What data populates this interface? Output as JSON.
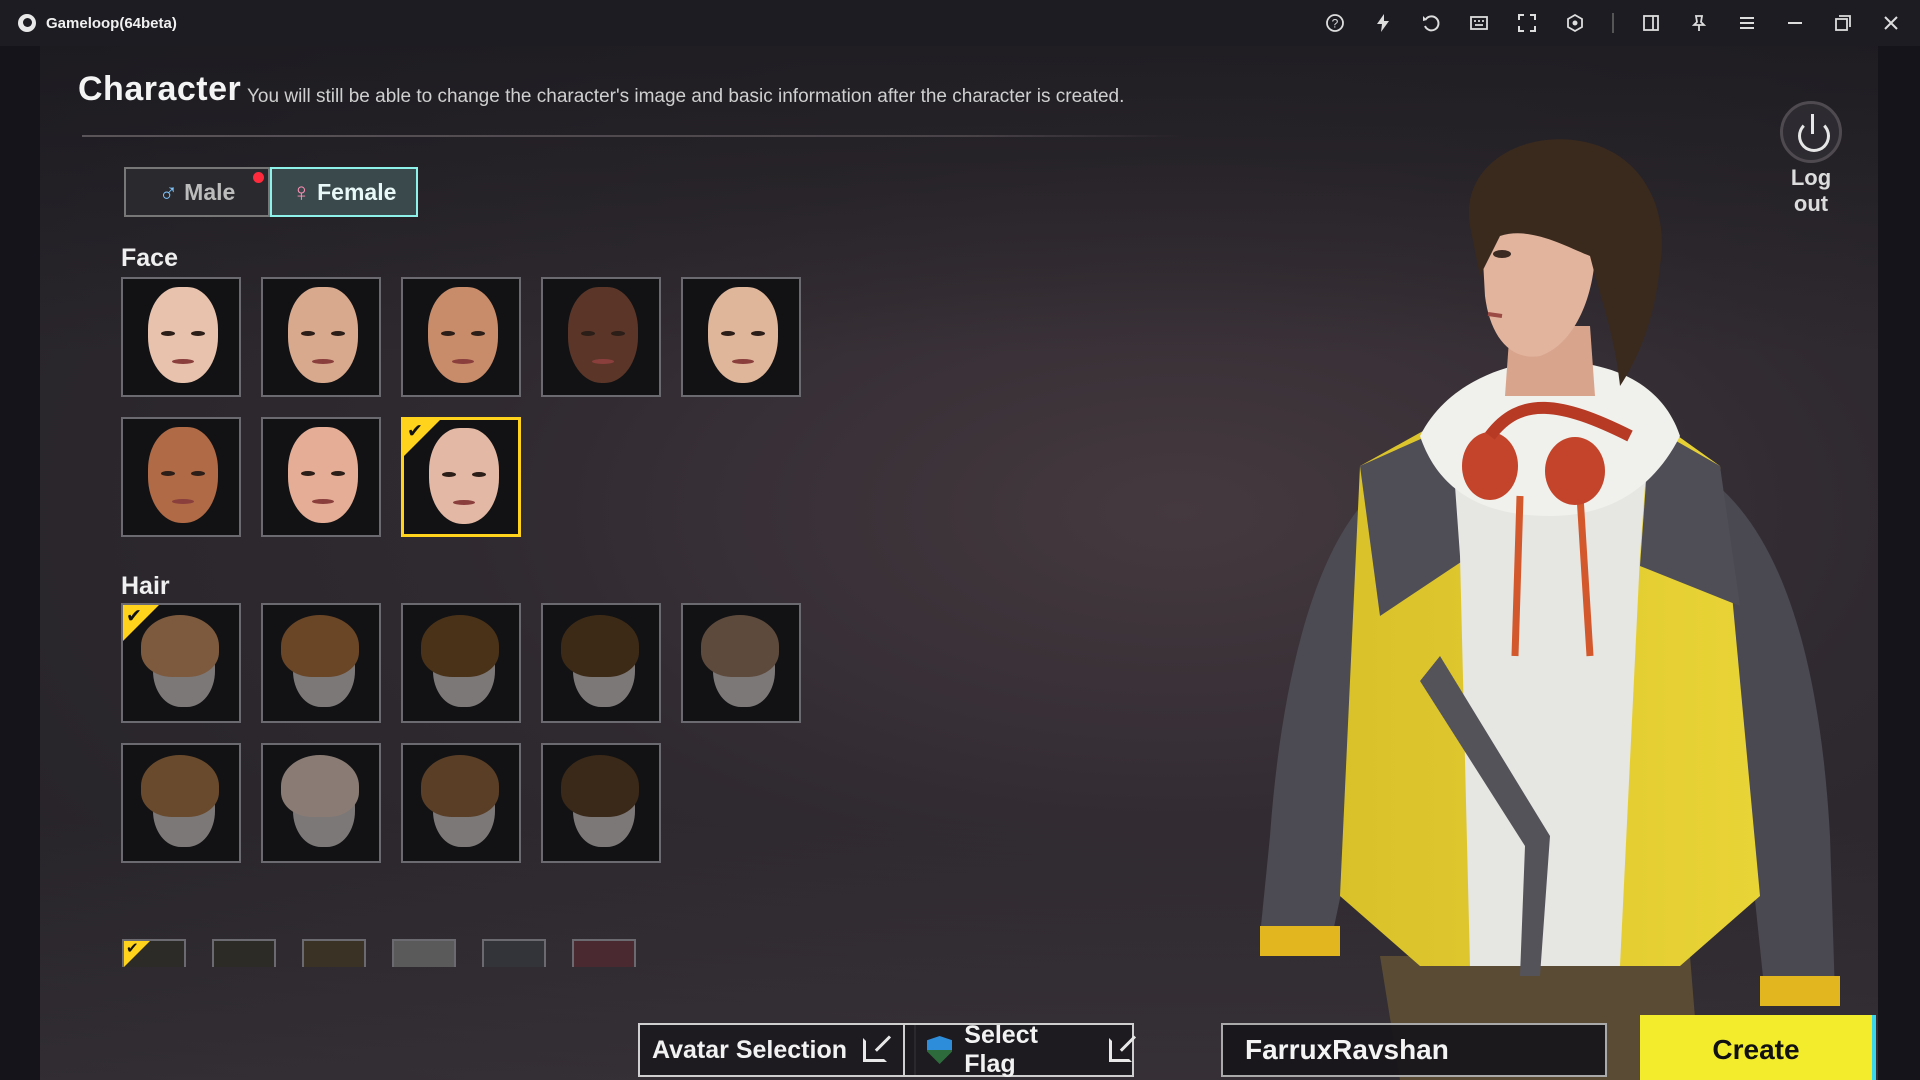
{
  "window": {
    "title": "Gameloop(64beta)"
  },
  "toolbar_icons": [
    "help-icon",
    "boost-icon",
    "rotate-icon",
    "keyboard-map-icon",
    "fullscreen-icon",
    "screenshot-icon",
    "sidebar-icon",
    "pin-icon",
    "menu-icon",
    "minimize-icon",
    "restore-icon",
    "close-icon"
  ],
  "header": {
    "title": "Character",
    "subtitle": "You will still be able to change the character's image and basic information after the character is created."
  },
  "gender": {
    "male": "Male",
    "female": "Female",
    "selected": "female"
  },
  "face": {
    "label": "Face",
    "options": [
      {
        "skin": "#e8c2ad"
      },
      {
        "skin": "#d9a98e"
      },
      {
        "skin": "#c98c6a"
      },
      {
        "skin": "#5b3628"
      },
      {
        "skin": "#e0b69b"
      },
      {
        "skin": "#b06a45"
      },
      {
        "skin": "#e5ad95"
      },
      {
        "skin": "#e3b8a4"
      }
    ],
    "selected_index": 7
  },
  "hair": {
    "label": "Hair",
    "options": [
      {
        "color": "#7d5a3e"
      },
      {
        "color": "#6a4526"
      },
      {
        "color": "#4a3218"
      },
      {
        "color": "#3d2a16"
      },
      {
        "color": "#5e4a3c"
      },
      {
        "color": "#6a4a2c"
      },
      {
        "color": "#8a7c74"
      },
      {
        "color": "#5a3e26"
      },
      {
        "color": "#3a2818"
      }
    ],
    "selected_index": 0
  },
  "hair_colors": {
    "options": [
      "#2c2b28",
      "#2d2b25",
      "#3b3226",
      "#5a5a5a",
      "#32343a",
      "#4a2a30"
    ],
    "selected_index": 0
  },
  "buttons": {
    "avatar": "Avatar Selection",
    "flag": "Select Flag",
    "create": "Create",
    "logout": "Log out"
  },
  "name_input": {
    "value": "FarruxRavshan"
  },
  "colors": {
    "accent_yellow": "#ffd21c",
    "accent_cyan": "#8ff2ea",
    "create_yellow": "#f2ec2c"
  }
}
